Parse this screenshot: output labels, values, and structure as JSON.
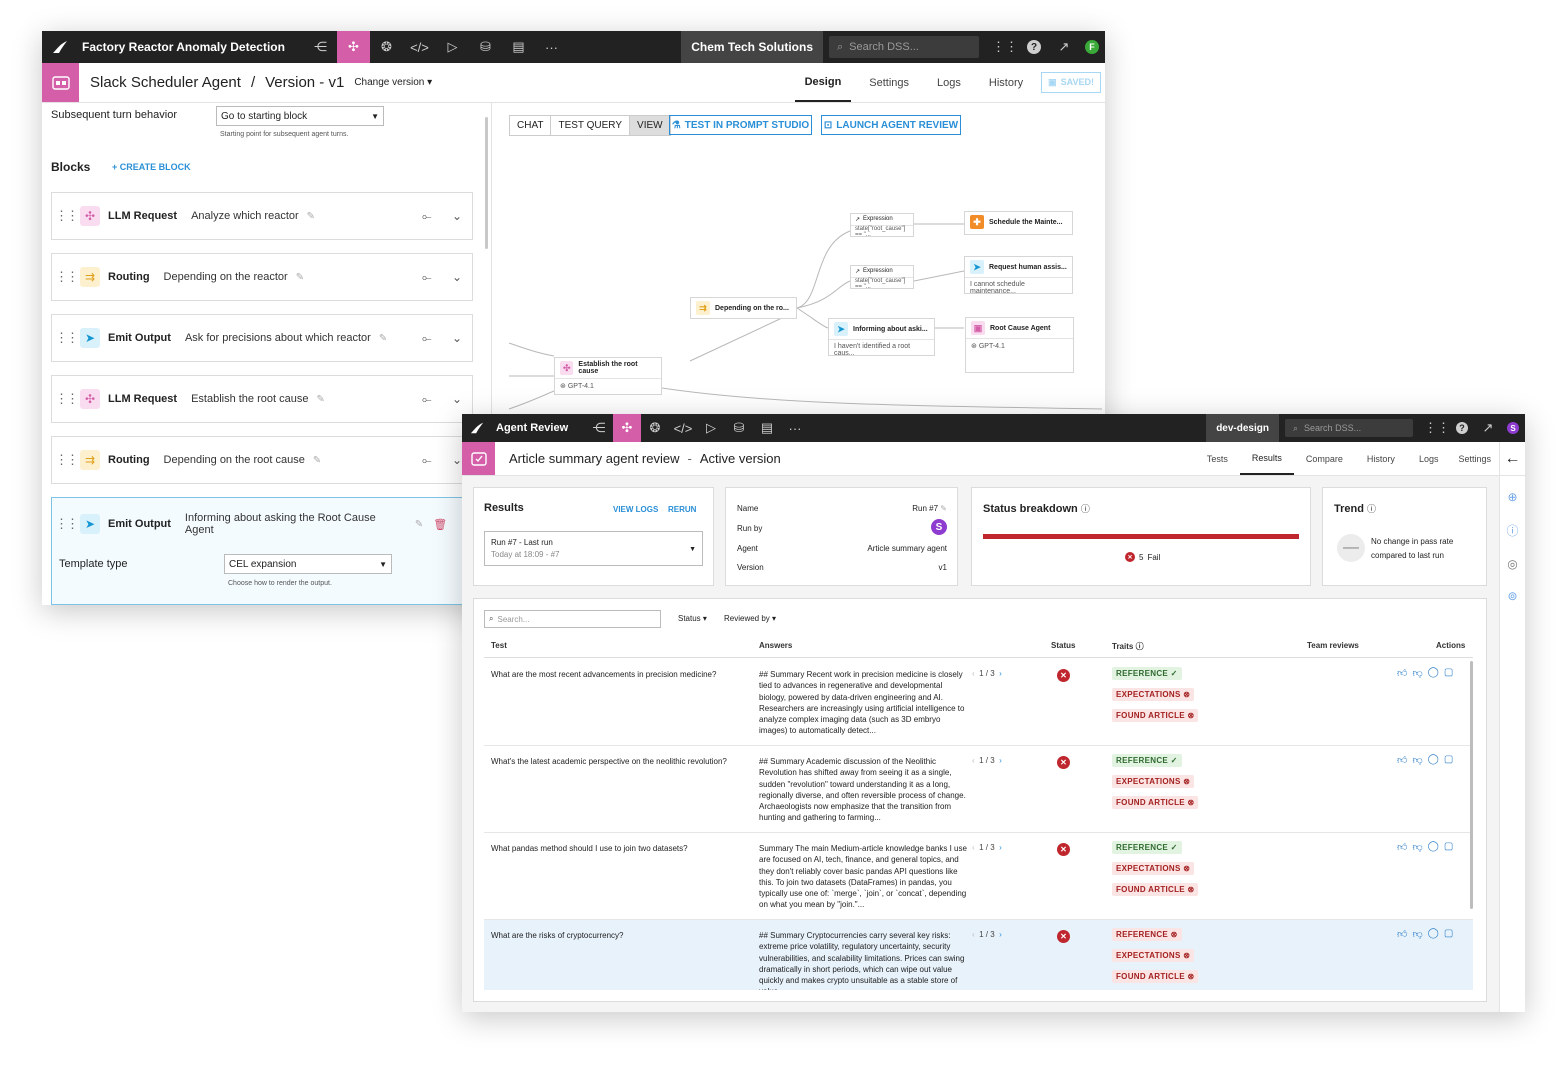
{
  "w1": {
    "project_title": "Factory Reactor Anomaly Detection",
    "org": "Chem Tech Solutions",
    "search_placeholder": "Search DSS...",
    "user_initial": "F",
    "agent_name": "Slack Scheduler Agent",
    "separator": "/",
    "version_label": "Version - v1",
    "change_version": "Change version",
    "tabs": [
      "Design",
      "Settings",
      "Logs",
      "History"
    ],
    "saved": "SAVED!",
    "turn_label": "Subsequent turn behavior",
    "turn_value": "Go to starting block",
    "turn_help": "Starting point for subsequent agent turns.",
    "blocks_title": "Blocks",
    "create_block": "CREATE BLOCK",
    "blocks": [
      {
        "type": "LLM Request",
        "desc": "Analyze which reactor"
      },
      {
        "type": "Routing",
        "desc": "Depending on the reactor"
      },
      {
        "type": "Emit Output",
        "desc": "Ask for precisions about which reactor"
      },
      {
        "type": "LLM Request",
        "desc": "Establish the root cause"
      },
      {
        "type": "Routing",
        "desc": "Depending on the root cause"
      },
      {
        "type": "Emit Output",
        "desc": "Informing about asking the Root Cause Agent"
      }
    ],
    "template_label": "Template type",
    "template_value": "CEL expansion",
    "template_help": "Choose how to render the output.",
    "view_tabs": [
      "CHAT",
      "TEST QUERY",
      "VIEW"
    ],
    "btn_prompt_studio": "TEST IN PROMPT STUDIO",
    "btn_launch_review": "LAUNCH AGENT REVIEW",
    "graph": {
      "expr_label": "Expression",
      "expr_body": "state[\"root_cause\"] == \"...",
      "schedule": "Schedule the Mainte...",
      "request_human": "Request human assis...",
      "request_human_body": "I cannot schedule maintenance...",
      "depending": "Depending on the ro...",
      "informing": "Informing about aski...",
      "informing_body": "I haven't identified a root caus...",
      "root_cause_agent": "Root Cause Agent",
      "model": "GPT-4.1",
      "establish": "Establish the root cause"
    }
  },
  "w2": {
    "app_title": "Agent Review",
    "env": "dev-design",
    "search_placeholder": "Search DSS...",
    "user_initial": "S",
    "page_title": "Article summary agent review",
    "dash": "-",
    "page_status": "Active version",
    "tabs": [
      "Tests",
      "Results",
      "Compare",
      "History",
      "Logs",
      "Settings"
    ],
    "results_title": "Results",
    "view_logs": "VIEW LOGS",
    "rerun": "RERUN",
    "run_select_main": "Run #7 - Last run",
    "run_select_sub": "Today at 18:09 - #7",
    "meta": {
      "name_label": "Name",
      "name_value": "Run #7",
      "runby_label": "Run by",
      "runby_initial": "S",
      "agent_label": "Agent",
      "agent_value": "Article summary agent",
      "version_label": "Version",
      "version_value": "v1"
    },
    "status_title": "Status breakdown",
    "status_fail_count": "5",
    "status_fail_label": "Fail",
    "status_fail_fraction": 1.0,
    "trend_title": "Trend",
    "trend_text1": "No change in pass rate",
    "trend_text2": "compared to last run",
    "table_search_placeholder": "Search...",
    "filter_status": "Status",
    "filter_reviewed": "Reviewed by",
    "columns": [
      "Test",
      "Answers",
      "Status",
      "Traits",
      "Team reviews",
      "Actions"
    ],
    "rows": [
      {
        "test": "What are the most recent advancements in precision medicine?",
        "answer": "## Summary Recent work in precision medicine is closely tied to advances in regenerative and developmental biology, powered by data-driven engineering and AI. Researchers are increasingly using artificial intelligence to analyze complex imaging data (such as 3D embryo images) to automatically detect...",
        "pager": "1 / 3",
        "traits": [
          {
            "label": "REFERENCE",
            "ok": true
          },
          {
            "label": "EXPECTATIONS",
            "ok": false
          },
          {
            "label": "FOUND ARTICLE",
            "ok": false
          }
        ]
      },
      {
        "test": "What's the latest academic perspective on the neolithic revolution?",
        "answer": "## Summary Academic discussion of the Neolithic Revolution has shifted away from seeing it as a single, sudden \"revolution\" toward understanding it as a long, regionally diverse, and often reversible process of change. Archaeologists now emphasize that the transition from hunting and gathering to farming...",
        "pager": "1 / 3",
        "traits": [
          {
            "label": "REFERENCE",
            "ok": true
          },
          {
            "label": "EXPECTATIONS",
            "ok": false
          },
          {
            "label": "FOUND ARTICLE",
            "ok": false
          }
        ]
      },
      {
        "test": "What pandas method should I use to join two datasets?",
        "answer": "Summary The main Medium-article knowledge banks I use are focused on AI, tech, finance, and general topics, and they don't reliably cover basic pandas API questions like this. To join two datasets (DataFrames) in pandas, you typically use one of: `merge`, `join`, or `concat`, depending on what you mean by \"join.\"...",
        "pager": "1 / 3",
        "traits": [
          {
            "label": "REFERENCE",
            "ok": true
          },
          {
            "label": "EXPECTATIONS",
            "ok": false
          },
          {
            "label": "FOUND ARTICLE",
            "ok": false
          }
        ]
      },
      {
        "test": "What are the risks of cryptocurrency?",
        "answer": "## Summary Cryptocurrencies carry several key risks: extreme price volatility, regulatory uncertainty, security vulnerabilities, and scalability limitations. Prices can swing dramatically in short periods, which can wipe out value quickly and makes crypto unsuitable as a stable store of value...",
        "pager": "1 / 3",
        "traits": [
          {
            "label": "REFERENCE",
            "ok": false
          },
          {
            "label": "EXPECTATIONS",
            "ok": false
          },
          {
            "label": "FOUND ARTICLE",
            "ok": false
          }
        ]
      }
    ]
  },
  "colors": {
    "pink": "#d45ea8",
    "fail_red": "#c0262d",
    "link_blue": "#2a8fd6",
    "topbar": "#222222"
  }
}
